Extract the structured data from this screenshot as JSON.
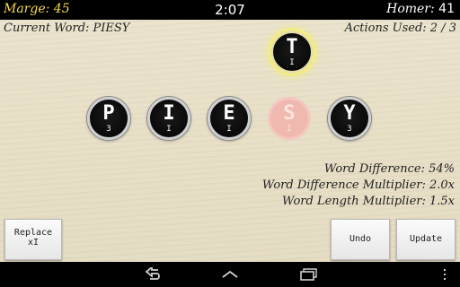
{
  "topbar": {
    "player1_score_text": "Marge: 45",
    "timer": "2:07",
    "player2_name": "Homer:",
    "player2_score": "41"
  },
  "status": {
    "current_word": "Current Word: PIESY",
    "actions_used": "Actions Used: 2 / 3"
  },
  "selected_tile": {
    "letter": "T",
    "sub": "I"
  },
  "tiles": [
    {
      "letter": "P",
      "sub": "3"
    },
    {
      "letter": "I",
      "sub": "I"
    },
    {
      "letter": "E",
      "sub": "I"
    },
    {
      "letter": "S",
      "sub": "I"
    },
    {
      "letter": "Y",
      "sub": "3"
    }
  ],
  "stats": {
    "word_difference": "Word Difference: 54%",
    "word_difference_multiplier": "Word Difference Multiplier: 2.0x",
    "word_length_multiplier": "Word Length Multiplier: 1.5x"
  },
  "buttons": {
    "replace_line1": "Replace",
    "replace_line2": "xI",
    "undo": "Undo",
    "update": "Update"
  },
  "colors": {
    "player1_score": "#f2d94e",
    "selected_glow": "#f4ee7a",
    "faded_tile": "#f0b9b0"
  },
  "icons": {
    "nav_back": "back-icon",
    "nav_home": "home-icon",
    "nav_recents": "recents-icon",
    "nav_menu": "overflow-menu-icon"
  }
}
